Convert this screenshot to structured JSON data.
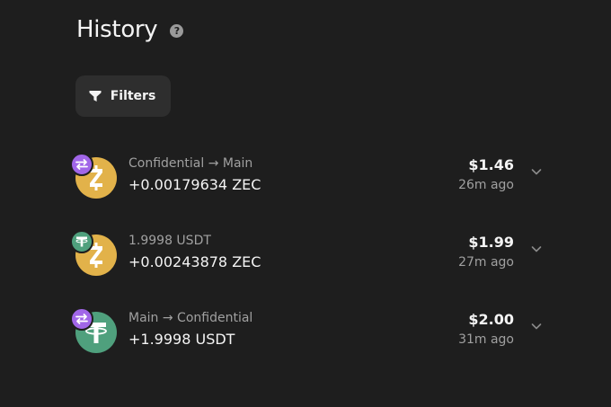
{
  "header": {
    "title": "History",
    "help_icon": "?"
  },
  "filters": {
    "label": "Filters",
    "icon": "funnel-icon"
  },
  "colors": {
    "background": "#1e1e1e",
    "zec": "#e2b24a",
    "usdt": "#4fa07d",
    "swap_badge": "#a166e8",
    "muted_text": "#a0a0a0"
  },
  "transactions": [
    {
      "subtitle": "Confidential → Main",
      "amount": "+0.00179634 ZEC",
      "usd": "$1.46",
      "time": "26m ago",
      "coin": "zec",
      "badge": "swap"
    },
    {
      "subtitle": "1.9998 USDT",
      "amount": "+0.00243878 ZEC",
      "usd": "$1.99",
      "time": "27m ago",
      "coin": "zec",
      "badge": "usdt"
    },
    {
      "subtitle": "Main → Confidential",
      "amount": "+1.9998 USDT",
      "usd": "$2.00",
      "time": "31m ago",
      "coin": "usdt",
      "badge": "swap"
    }
  ]
}
